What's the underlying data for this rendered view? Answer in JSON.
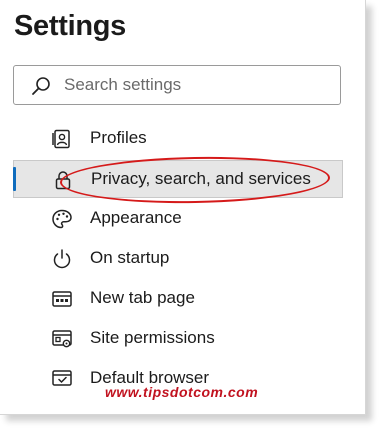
{
  "page": {
    "title": "Settings"
  },
  "search": {
    "placeholder": "Search settings",
    "icon": "search-icon"
  },
  "nav": {
    "items": [
      {
        "label": "Profiles",
        "icon": "profile-icon",
        "selected": false
      },
      {
        "label": "Privacy, search, and services",
        "icon": "lock-icon",
        "selected": true
      },
      {
        "label": "Appearance",
        "icon": "palette-icon",
        "selected": false
      },
      {
        "label": "On startup",
        "icon": "power-icon",
        "selected": false
      },
      {
        "label": "New tab page",
        "icon": "new-tab-icon",
        "selected": false
      },
      {
        "label": "Site permissions",
        "icon": "site-permissions-icon",
        "selected": false
      },
      {
        "label": "Default browser",
        "icon": "default-browser-icon",
        "selected": false
      }
    ]
  },
  "watermark": {
    "text": "www.tipsdotcom.com"
  },
  "colors": {
    "accent": "#0f6cbd",
    "annotation": "#d51a1a",
    "watermark": "#c1121f"
  }
}
